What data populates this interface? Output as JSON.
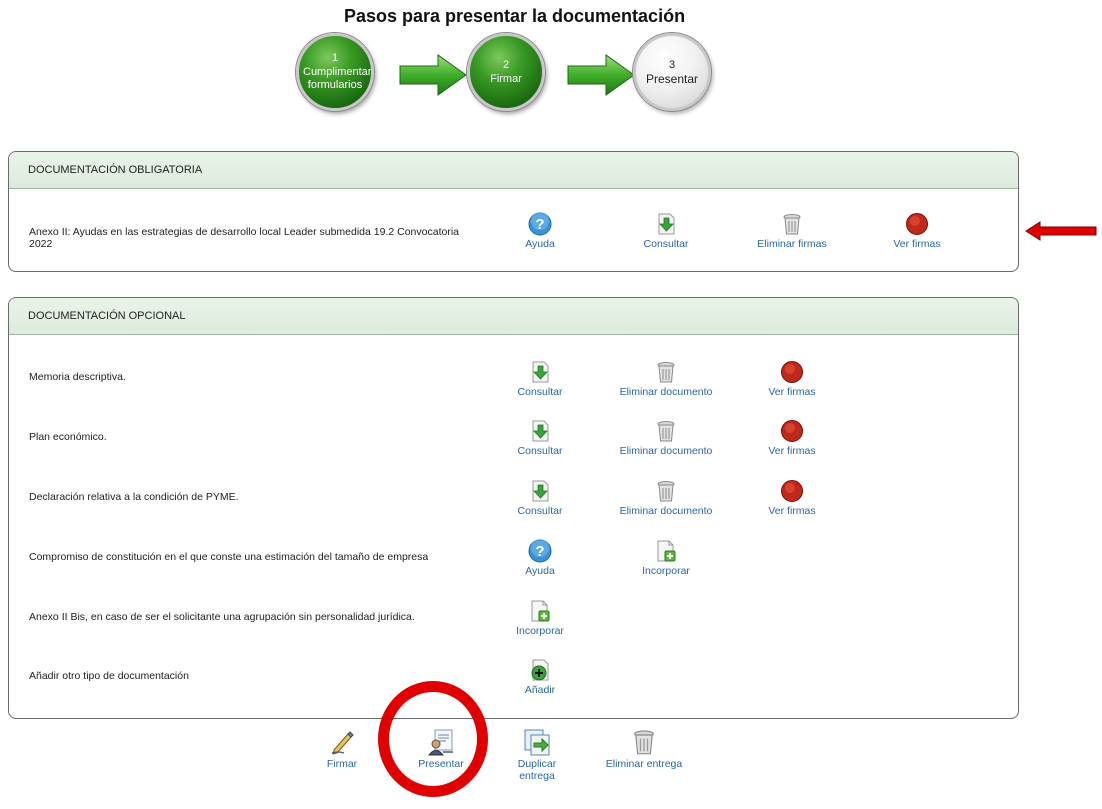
{
  "page_title": "Pasos para presentar la documentación",
  "steps": [
    {
      "num": "1",
      "label": "Cumplimentar formularios"
    },
    {
      "num": "2",
      "label": "Firmar"
    },
    {
      "num": "3",
      "label": "Presentar"
    }
  ],
  "mandatory": {
    "header": "DOCUMENTACIÓN OBLIGATORIA",
    "row": {
      "label": "Anexo II: Ayudas en las estrategias de desarrollo local Leader submedida 19.2 Convocatoria 2022",
      "actions": [
        "Ayuda",
        "Consultar",
        "Eliminar firmas",
        "Ver firmas"
      ]
    }
  },
  "optional": {
    "header": "DOCUMENTACIÓN OPCIONAL",
    "rows": [
      {
        "label": "Memoria descriptiva.",
        "actions": [
          "Consultar",
          "Eliminar documento",
          "Ver firmas"
        ]
      },
      {
        "label": "Plan económico.",
        "actions": [
          "Consultar",
          "Eliminar documento",
          "Ver firmas"
        ]
      },
      {
        "label": "Declaración relativa a la condición de PYME.",
        "actions": [
          "Consultar",
          "Eliminar documento",
          "Ver firmas"
        ]
      },
      {
        "label": "Compromiso de constitución en el que conste una estimación del tamaño de empresa",
        "actions": [
          "Ayuda",
          "Incorporar"
        ]
      },
      {
        "label": "Anexo II Bis, en caso de ser el solicitante una agrupación sin personalidad jurídica.",
        "actions": [
          "Incorporar"
        ]
      },
      {
        "label": "Añadir otro tipo de documentación",
        "actions": [
          "Añadir"
        ]
      }
    ]
  },
  "bottom_actions": [
    "Firmar",
    "Presentar",
    "Duplicar entrega",
    "Eliminar entrega"
  ],
  "colors": {
    "link": "#2a66a8",
    "annotation": "#e00000",
    "header_bg": "#dcebdc"
  }
}
